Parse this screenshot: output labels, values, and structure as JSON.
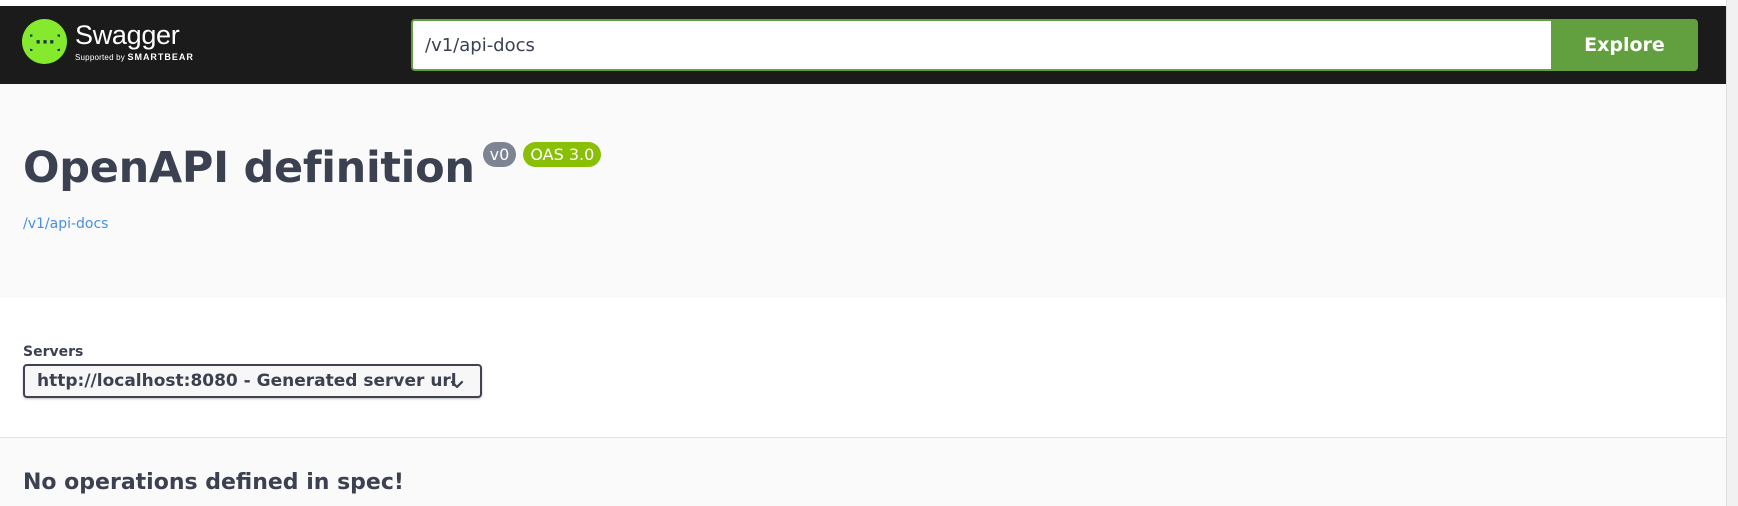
{
  "topbar": {
    "brand_name": "Swagger",
    "brand_supported": "Supported by",
    "brand_company": "SMARTBEAR",
    "logo_icon": "swagger-braces-icon",
    "url_value": "/v1/api-docs",
    "explore_label": "Explore"
  },
  "info": {
    "title": "OpenAPI definition",
    "version_badge": "v0",
    "oas_badge": "OAS 3.0",
    "spec_link": "/v1/api-docs"
  },
  "servers": {
    "label": "Servers",
    "selected": "http://localhost:8080 - Generated server url"
  },
  "operations": {
    "empty_message": "No operations defined in spec!"
  },
  "colors": {
    "topbar_bg": "#1b1b1b",
    "accent_green": "#62a03f",
    "logo_green": "#85ea2d",
    "oas_badge": "#89bf04",
    "version_badge": "#7d8492",
    "link_blue": "#4990e2"
  }
}
